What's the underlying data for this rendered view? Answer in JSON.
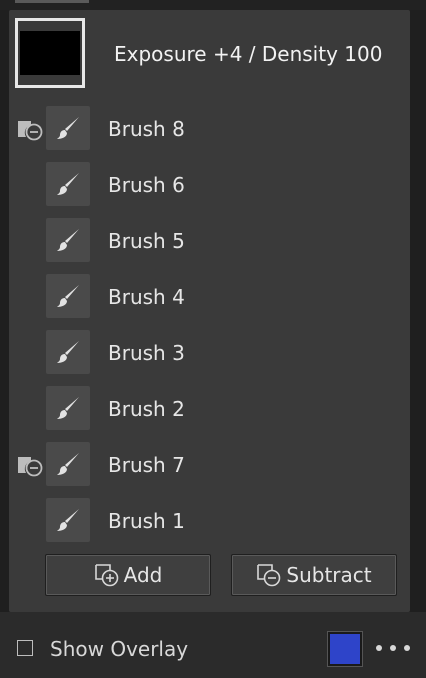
{
  "mask": {
    "label": "Exposure +4 / Density 100"
  },
  "brushes": [
    {
      "label": "Brush 8",
      "subtract": true
    },
    {
      "label": "Brush 6",
      "subtract": false
    },
    {
      "label": "Brush 5",
      "subtract": false
    },
    {
      "label": "Brush 4",
      "subtract": false
    },
    {
      "label": "Brush 3",
      "subtract": false
    },
    {
      "label": "Brush 2",
      "subtract": false
    },
    {
      "label": "Brush 7",
      "subtract": true
    },
    {
      "label": "Brush 1",
      "subtract": false
    }
  ],
  "actions": {
    "add_label": "Add",
    "subtract_label": "Subtract"
  },
  "overlay": {
    "label": "Show Overlay",
    "checked": false,
    "color": "#2e44c9"
  },
  "icons": {
    "brush": "brush-icon",
    "subtract_badge": "subtract-mode-icon",
    "add": "add-mask-icon",
    "subtract": "subtract-mask-icon",
    "more": "more-icon"
  }
}
